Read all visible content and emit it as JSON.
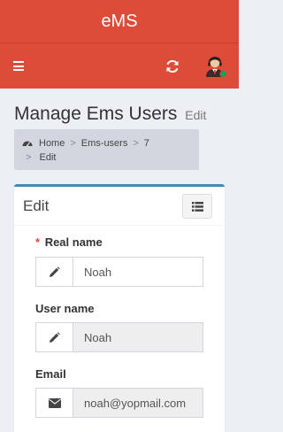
{
  "app": {
    "title": "eMS"
  },
  "navbar": {
    "menu_icon": "hamburger-icon",
    "refresh_icon": "refresh-icon",
    "avatar_icon": "user-avatar-icon"
  },
  "page": {
    "title": "Manage Ems Users",
    "subtitle": "Edit"
  },
  "breadcrumb": {
    "home": "Home",
    "users": "Ems-users",
    "id": "7",
    "current": "Edit",
    "separator": ">"
  },
  "form": {
    "title": "Edit",
    "required_mark": "*",
    "fields": [
      {
        "label": "Real name",
        "value": "Noah",
        "icon": "pencil-icon",
        "readonly": false
      },
      {
        "label": "User name",
        "value": "Noah",
        "icon": "pencil-icon",
        "readonly": true
      },
      {
        "label": "Email",
        "value": "noah@yopmail.com",
        "icon": "envelope-icon",
        "readonly": true
      }
    ]
  },
  "colors": {
    "header": "#dd4b39",
    "box_accent": "#3c8dbc",
    "background": "#ecf0f5",
    "online": "#00a65a"
  }
}
